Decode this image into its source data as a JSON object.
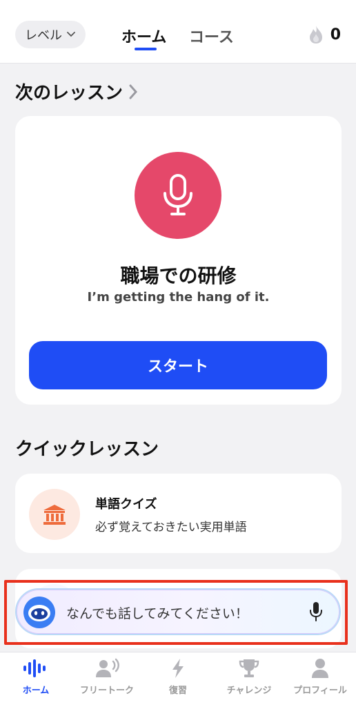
{
  "header": {
    "level_label": "レベル",
    "tabs": [
      {
        "label": "ホーム",
        "active": true
      },
      {
        "label": "コース",
        "active": false
      }
    ],
    "streak_count": "0",
    "icons": {
      "level_dropdown": "chevron-down-icon",
      "streak": "flame-icon"
    }
  },
  "next_lesson": {
    "section_title": "次のレッスン",
    "title": "職場での研修",
    "subtitle": "I’m getting the hang of it.",
    "start_label": "スタート",
    "icon": "microphone-icon",
    "accent_color": "#e5486a"
  },
  "quick_lessons": {
    "section_title": "クイックレッスン",
    "items": [
      {
        "name": "単語クイズ",
        "description": "必ず覚えておきたい実用単語",
        "icon": "bank-icon"
      }
    ]
  },
  "chat": {
    "placeholder": "なんでも話してみてください！",
    "icons": {
      "avatar": "bot-avatar-icon",
      "mic": "microphone-icon"
    }
  },
  "nav": {
    "items": [
      {
        "label": "ホーム",
        "icon": "waveform-icon",
        "active": true
      },
      {
        "label": "フリートーク",
        "icon": "speaking-person-icon",
        "active": false
      },
      {
        "label": "復習",
        "icon": "lightning-icon",
        "active": false
      },
      {
        "label": "チャレンジ",
        "icon": "trophy-icon",
        "active": false
      },
      {
        "label": "プロフィール",
        "icon": "person-icon",
        "active": false
      }
    ]
  },
  "colors": {
    "primary": "#1f4df5",
    "background": "#f2f2f4",
    "highlight_frame": "#e8301c"
  }
}
